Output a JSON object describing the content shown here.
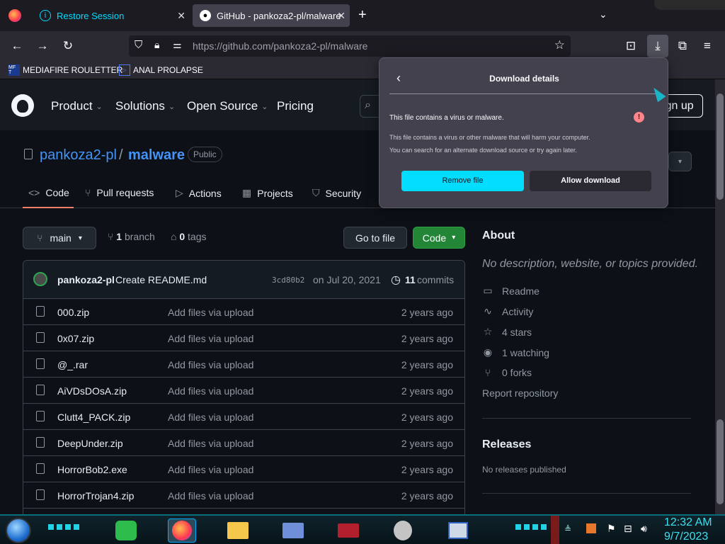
{
  "browser": {
    "tabs": [
      {
        "title": "Restore Session",
        "icon": "info-icon"
      },
      {
        "title": "GitHub - pankoza2-pl/malware",
        "icon": "github-icon"
      }
    ],
    "new_tab_label": "+",
    "url": "https://github.com/pankoza2-pl/malware",
    "bookmarks": [
      {
        "label": "MEDIAFIRE ROULETTER",
        "icon_text": "MF T"
      },
      {
        "label": "ANAL PROLAPSE",
        "icon": "triangle-icon"
      }
    ]
  },
  "github": {
    "nav": [
      "Product",
      "Solutions",
      "Open Source",
      "Pricing"
    ],
    "signup_label": "Sign up",
    "repo": {
      "owner": "pankoza2-pl",
      "separator": "/",
      "name": "malware",
      "visibility": "Public"
    },
    "tabs": [
      {
        "label": "Code",
        "icon": "<>"
      },
      {
        "label": "Pull requests",
        "icon": "⑂"
      },
      {
        "label": "Actions",
        "icon": "▷"
      },
      {
        "label": "Projects",
        "icon": "▦"
      },
      {
        "label": "Security",
        "icon": "⛉"
      }
    ],
    "branch_button": "main",
    "branch_count": "1",
    "branch_label": "branch",
    "tag_count": "0",
    "tag_label": "tags",
    "goto_file": "Go to file",
    "code_button": "Code",
    "commit": {
      "author": "pankoza2-pl",
      "message": "Create README.md",
      "sha": "3cd80b2",
      "date": "on Jul 20, 2021",
      "commits_count": "11",
      "commits_label": "commits"
    },
    "files": [
      {
        "name": "000.zip",
        "message": "Add files via upload",
        "date": "2 years ago"
      },
      {
        "name": "0x07.zip",
        "message": "Add files via upload",
        "date": "2 years ago"
      },
      {
        "name": "@_.rar",
        "message": "Add files via upload",
        "date": "2 years ago"
      },
      {
        "name": "AiVDsDOsA.zip",
        "message": "Add files via upload",
        "date": "2 years ago"
      },
      {
        "name": "Clutt4_PACK.zip",
        "message": "Add files via upload",
        "date": "2 years ago"
      },
      {
        "name": "DeepUnder.zip",
        "message": "Add files via upload",
        "date": "2 years ago"
      },
      {
        "name": "HorrorBob2.exe",
        "message": "Add files via upload",
        "date": "2 years ago"
      },
      {
        "name": "HorrorTrojan4.zip",
        "message": "Add files via upload",
        "date": "2 years ago"
      }
    ],
    "about": {
      "title": "About",
      "description": "No description, website, or topics provided.",
      "items": [
        {
          "label": "Readme",
          "icon": "book-icon"
        },
        {
          "label": "Activity",
          "icon": "pulse-icon"
        },
        {
          "label": "4 stars",
          "icon": "star-icon"
        },
        {
          "label": "1 watching",
          "icon": "eye-icon"
        },
        {
          "label": "0 forks",
          "icon": "fork-icon"
        }
      ],
      "report": "Report repository",
      "releases_title": "Releases",
      "releases_text": "No releases published"
    }
  },
  "download_panel": {
    "title": "Download details",
    "warning": "This file contains a virus or malware.",
    "description_line1": "This file contains a virus or other malware that will harm your computer.",
    "description_line2": "You can search for an alternate download source or try again later.",
    "remove_button": "Remove file",
    "allow_button": "Allow download"
  },
  "taskbar": {
    "time": "12:32 AM",
    "date": "9/7/2023"
  },
  "colors": {
    "accent_cyan": "#00ddff",
    "github_green": "#238636",
    "github_link": "#4493f8"
  }
}
